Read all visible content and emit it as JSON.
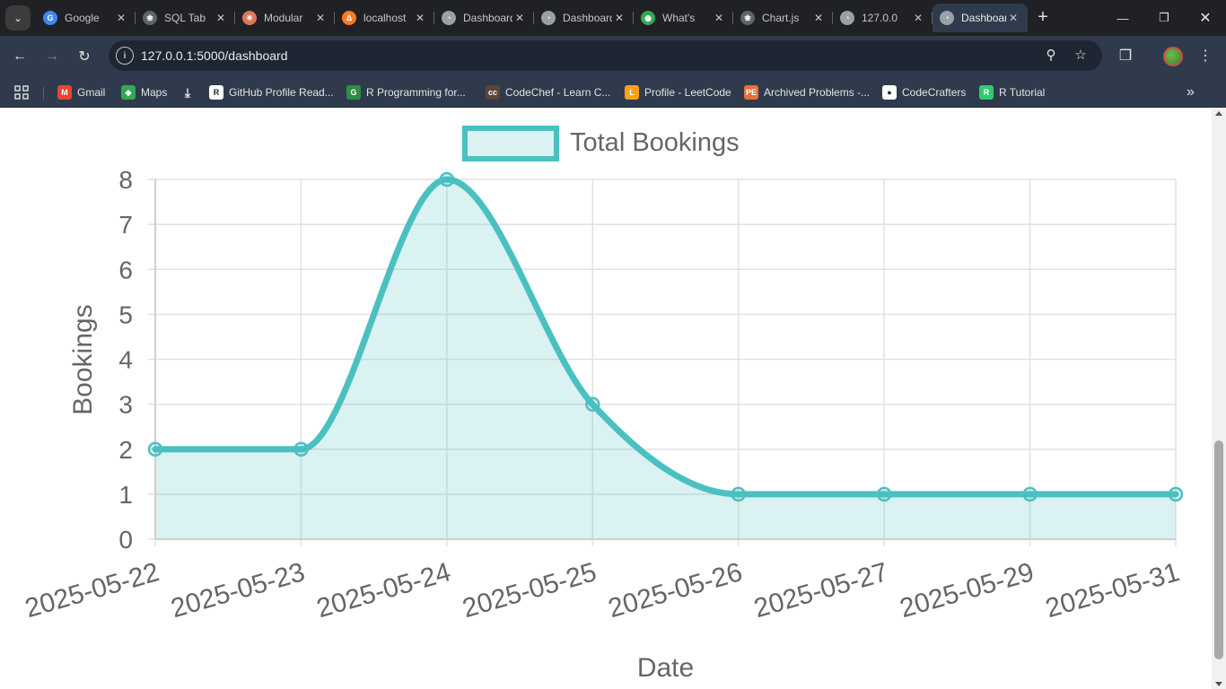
{
  "browser": {
    "tabs": [
      {
        "title": "Google",
        "favicon": "google-translate-icon",
        "color": "#4285f4"
      },
      {
        "title": "SQL Tab",
        "favicon": "openai-icon",
        "color": "#5f6368"
      },
      {
        "title": "Modular",
        "favicon": "asterisk-icon",
        "color": "#d97757"
      },
      {
        "title": "localhost",
        "favicon": "xampp-icon",
        "color": "#fb7a24"
      },
      {
        "title": "Dashboard",
        "favicon": "globe-icon",
        "color": "#9aa0a6"
      },
      {
        "title": "Dashboard",
        "favicon": "globe-icon",
        "color": "#9aa0a6"
      },
      {
        "title": "What's",
        "favicon": "chrome-icon",
        "color": "#34a853"
      },
      {
        "title": "Chart.js",
        "favicon": "openai-icon",
        "color": "#5f6368"
      },
      {
        "title": "127.0.0",
        "favicon": "globe-icon",
        "color": "#9aa0a6"
      },
      {
        "title": "Dashboard",
        "favicon": "globe-icon",
        "color": "#9aa0a6",
        "active": true
      }
    ],
    "url": "127.0.0.1:5000/dashboard",
    "bookmarks": [
      {
        "label": "Gmail",
        "icon": "gmail-icon",
        "color": "#ea4335"
      },
      {
        "label": "Maps",
        "icon": "maps-icon",
        "color": "#34a853"
      },
      {
        "label": "",
        "icon": "download-icon",
        "color": "#e3e3e3"
      },
      {
        "label": "GitHub Profile Read...",
        "icon": "github-readme-icon",
        "color": "#ffffff"
      },
      {
        "label": "R Programming for...",
        "icon": "gfg-icon",
        "color": "#2f8d46"
      },
      {
        "label": "CodeChef - Learn C...",
        "icon": "codechef-icon",
        "color": "#5b4638"
      },
      {
        "label": "Profile - LeetCode",
        "icon": "leetcode-icon",
        "color": "#ffa116"
      },
      {
        "label": "Archived Problems -...",
        "icon": "projecteuler-icon",
        "color": "#e8703a"
      },
      {
        "label": "CodeCrafters",
        "icon": "github-icon",
        "color": "#ffffff"
      },
      {
        "label": "R Tutorial",
        "icon": "r-tutorial-icon",
        "color": "#2ecc71"
      }
    ]
  },
  "chart_data": {
    "type": "line",
    "fill": true,
    "smooth": true,
    "title": "",
    "legend": {
      "position": "top",
      "entries": [
        "Total Bookings"
      ]
    },
    "categories": [
      "2025-05-22",
      "2025-05-23",
      "2025-05-24",
      "2025-05-25",
      "2025-05-26",
      "2025-05-27",
      "2025-05-29",
      "2025-05-31"
    ],
    "series": [
      {
        "name": "Total Bookings",
        "values": [
          2,
          2,
          8,
          3,
          1,
          1,
          1,
          1
        ],
        "color": "#4bc0c0",
        "fill_color": "rgba(75,192,192,0.2)"
      }
    ],
    "xlabel": "Date",
    "ylabel": "Bookings",
    "ylim": [
      0,
      8
    ],
    "yticks": [
      "0",
      "1",
      "2",
      "3",
      "4",
      "5",
      "6",
      "7",
      "8"
    ],
    "grid": true
  }
}
